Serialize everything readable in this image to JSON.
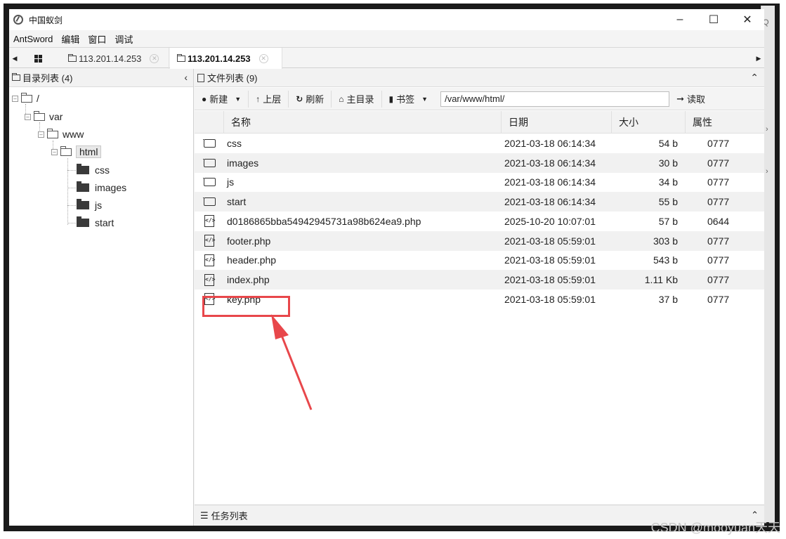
{
  "window": {
    "title": "中国蚁剑"
  },
  "menu": [
    "AntSword",
    "编辑",
    "窗口",
    "调试"
  ],
  "tabs": [
    {
      "label": "113.201.14.253",
      "active": false
    },
    {
      "label": "113.201.14.253",
      "active": true
    }
  ],
  "left_panel": {
    "header": "目录列表 (4)",
    "tree": {
      "root": "/",
      "var": "var",
      "www": "www",
      "html": "html",
      "children": [
        "css",
        "images",
        "js",
        "start"
      ]
    }
  },
  "right_panel": {
    "header": "文件列表 (9)",
    "toolbar": {
      "new": "新建",
      "up": "上层",
      "refresh": "刷新",
      "home": "主目录",
      "bookmark": "书签",
      "path": "/var/www/html/",
      "read": "读取"
    },
    "columns": {
      "name": "名称",
      "date": "日期",
      "size": "大小",
      "attr": "属性"
    },
    "files": [
      {
        "icon": "folder-icon",
        "name": "css",
        "date": "2021-03-18 06:14:34",
        "size": "54 b",
        "attr": "0777"
      },
      {
        "icon": "folder-icon",
        "name": "images",
        "date": "2021-03-18 06:14:34",
        "size": "30 b",
        "attr": "0777"
      },
      {
        "icon": "folder-icon",
        "name": "js",
        "date": "2021-03-18 06:14:34",
        "size": "34 b",
        "attr": "0777"
      },
      {
        "icon": "folder-icon",
        "name": "start",
        "date": "2021-03-18 06:14:34",
        "size": "55 b",
        "attr": "0777"
      },
      {
        "icon": "php-file-icon",
        "name": "d0186865bba54942945731a98b624ea9.php",
        "date": "2025-10-20 10:07:01",
        "size": "57 b",
        "attr": "0644"
      },
      {
        "icon": "php-file-icon",
        "name": "footer.php",
        "date": "2021-03-18 05:59:01",
        "size": "303 b",
        "attr": "0777"
      },
      {
        "icon": "php-file-icon",
        "name": "header.php",
        "date": "2021-03-18 05:59:01",
        "size": "543 b",
        "attr": "0777"
      },
      {
        "icon": "php-file-icon",
        "name": "index.php",
        "date": "2021-03-18 05:59:01",
        "size": "1.11 Kb",
        "attr": "0777"
      },
      {
        "icon": "php-file-icon",
        "name": "key.php",
        "date": "2021-03-18 05:59:01",
        "size": "37 b",
        "attr": "0777"
      }
    ],
    "highlighted_file": "key.php",
    "highlight_color": "#e8474b",
    "tasks": "任务列表"
  },
  "watermark": "CSDN @mooyuan天天"
}
